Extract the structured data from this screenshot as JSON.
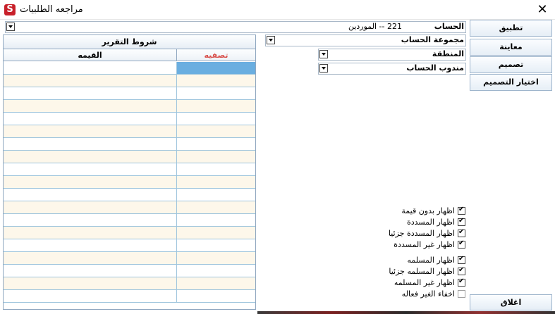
{
  "window": {
    "title": "مراجعه الطلبيات",
    "app_icon_letter": "S",
    "close_glyph": "✕"
  },
  "fields": {
    "account": {
      "label": "الحساب",
      "value": "221 -- الموردين"
    },
    "account_group": {
      "label": "مجموعة الحساب",
      "value": ""
    },
    "region": {
      "label": "المنطقة",
      "value": ""
    },
    "account_rep": {
      "label": "مندوب الحساب",
      "value": ""
    }
  },
  "buttons": {
    "apply": "تطبيق",
    "preview": "معاينة",
    "design": "تصميم",
    "choose_design": "اختيار التصميم",
    "close": "اغلاق"
  },
  "report_conditions": {
    "title": "شروط التقرير",
    "col_value": "القيمه",
    "col_filter": "تصفيه",
    "row_count": 19
  },
  "options_group1": [
    {
      "label": "اظهار بدون قيمة",
      "checked": true
    },
    {
      "label": "اظهار المسددة",
      "checked": true
    },
    {
      "label": "اظهار المسددة جزئيا",
      "checked": true
    },
    {
      "label": "اظهار غير المسددة",
      "checked": true
    }
  ],
  "options_group2": [
    {
      "label": "اظهار المسلمه",
      "checked": true
    },
    {
      "label": "اظهار المسلمه جزئيا",
      "checked": true
    },
    {
      "label": "اظهار غير المسلمه",
      "checked": true
    },
    {
      "label": "اخفاء الغير فعاله",
      "checked": false
    }
  ],
  "colors": {
    "accent_filter_header": "#d9534f",
    "selected_cell": "#6aaee0",
    "alt_row": "#fdf7ea"
  }
}
